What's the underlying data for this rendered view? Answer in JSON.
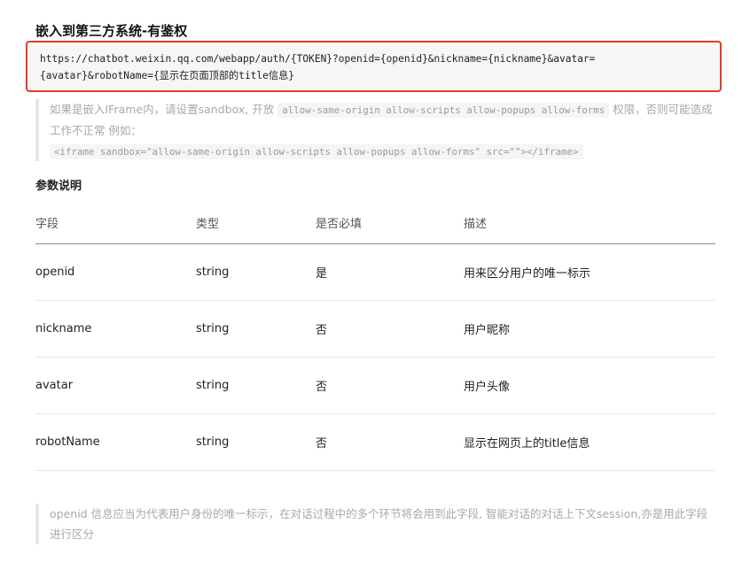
{
  "title": "嵌入到第三方系统-有鉴权",
  "code": {
    "line1": "https://chatbot.weixin.qq.com/webapp/auth/{TOKEN}?openid={openid}&nickname={nickname}&avatar=",
    "line2": "{avatar}&robotName={显示在页面顶部的title信息}"
  },
  "note1": {
    "text_a": "如果是嵌入IFrame内，请设置sandbox, 开放 ",
    "code_a": "allow-same-origin allow-scripts allow-popups allow-forms",
    "text_b": " 权限，否则可能造成工作不正常 例如：",
    "code_b": "<iframe sandbox=\"allow-same-origin allow-scripts allow-popups allow-forms\" src=\"\"></iframe>"
  },
  "params_heading": "参数说明",
  "table": {
    "headers": [
      "字段",
      "类型",
      "是否必填",
      "描述"
    ],
    "rows": [
      [
        "openid",
        "string",
        "是",
        "用来区分用户的唯一标示"
      ],
      [
        "nickname",
        "string",
        "否",
        "用户昵称"
      ],
      [
        "avatar",
        "string",
        "否",
        "用户头像"
      ],
      [
        "robotName",
        "string",
        "否",
        "显示在网页上的title信息"
      ]
    ]
  },
  "note2": "openid 信息应当为代表用户身份的唯一标示，在对话过程中的多个环节将会用到此字段, 智能对话的对话上下文session,亦是用此字段进行区分"
}
